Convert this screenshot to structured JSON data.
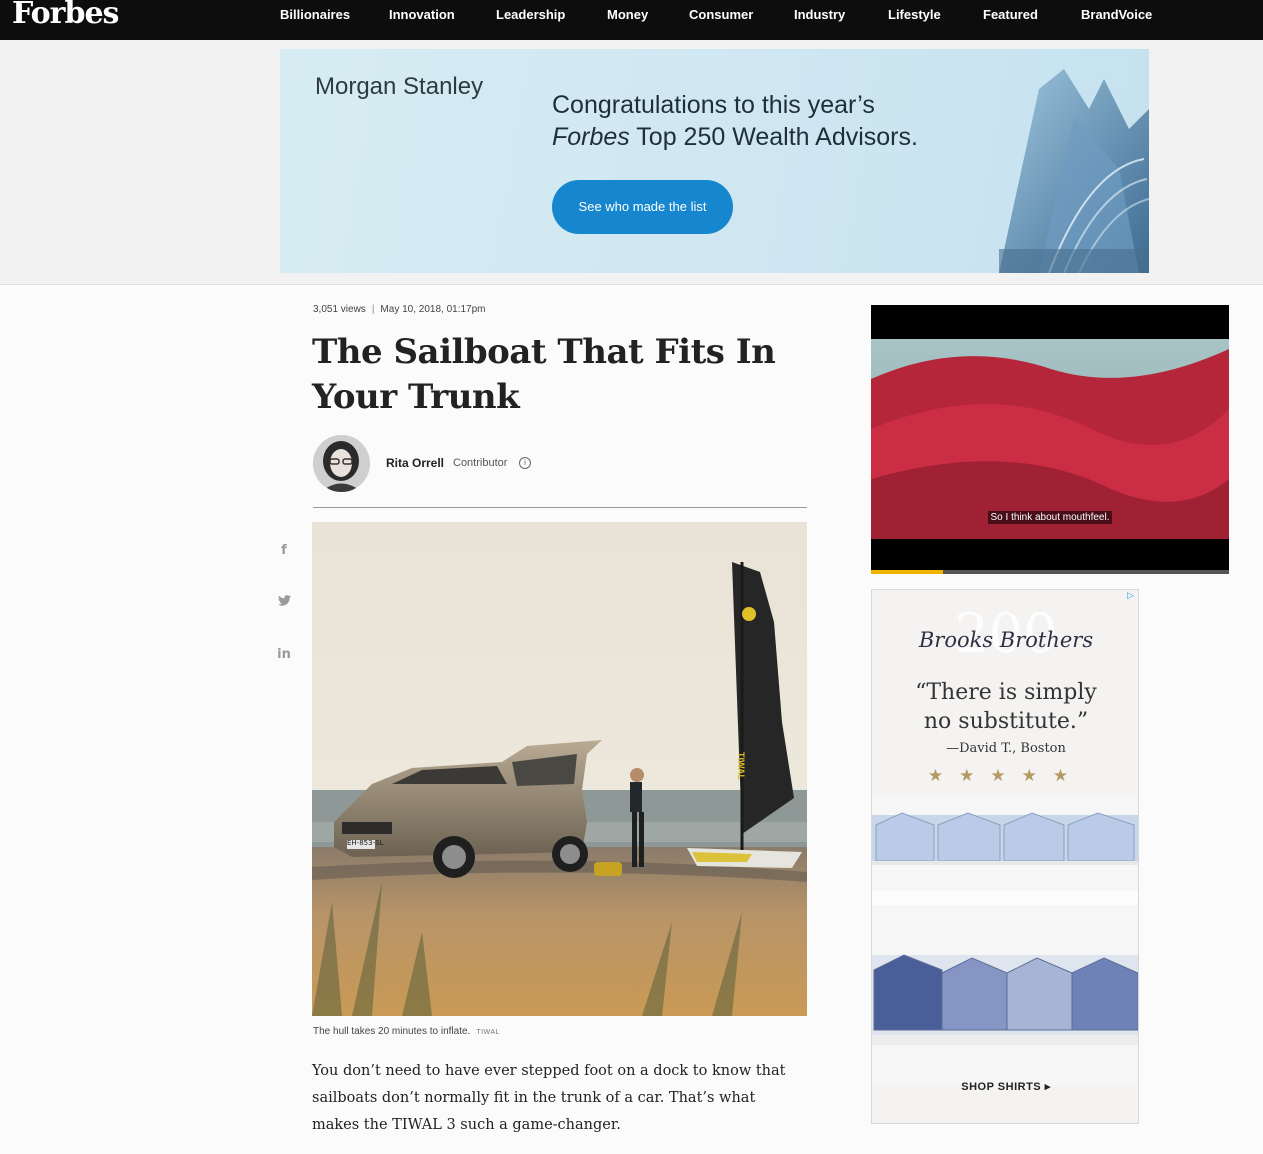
{
  "brand": {
    "logo": "Forbes"
  },
  "nav": {
    "items": [
      "Billionaires",
      "Innovation",
      "Leadership",
      "Money",
      "Consumer",
      "Industry",
      "Lifestyle",
      "Featured",
      "BrandVoice"
    ]
  },
  "banner_ad": {
    "advertiser": "Morgan Stanley",
    "headline_line1": "Congratulations to this year’s",
    "headline_line2_italic": "Forbes",
    "headline_line2_rest": " Top 250 Wealth Advisors.",
    "cta": "See who made the list"
  },
  "article": {
    "views": "3,051 views",
    "meta_separator": "|",
    "date": "May 10, 2018, 01:17pm",
    "title": "The Sailboat That Fits In Your Trunk",
    "author_name": "Rita Orrell",
    "author_role": "Contributor",
    "info_glyph": "i",
    "share": {
      "facebook": "f",
      "twitter": "🐦",
      "linkedin": "in"
    },
    "image_caption": "The hull takes 20 minutes to inflate.",
    "image_credit": "TIWAL",
    "license_plate": "EH-853-SL",
    "sail_brand": "TIWAL",
    "body": "You don’t need to have ever stepped foot on a dock to know that sailboats don’t normally fit in the trunk of a car. That’s what makes the TIWAL 3 such a game-changer."
  },
  "video": {
    "subtitle": "So I think about mouthfeel.",
    "progress": 0.2
  },
  "side_ad": {
    "brand": "Brooks Brothers",
    "anniversary": "200",
    "quote": "“There is simply no substitute.”",
    "attribution": "—David T., Boston",
    "stars": "★★★★★",
    "cta": "SHOP SHIRTS ▸",
    "adchoices": "▷"
  },
  "icons": {
    "share_facebook": "facebook-icon",
    "share_twitter": "twitter-icon",
    "share_linkedin": "linkedin-icon",
    "info": "info-icon",
    "adchoices": "adchoices-icon"
  }
}
